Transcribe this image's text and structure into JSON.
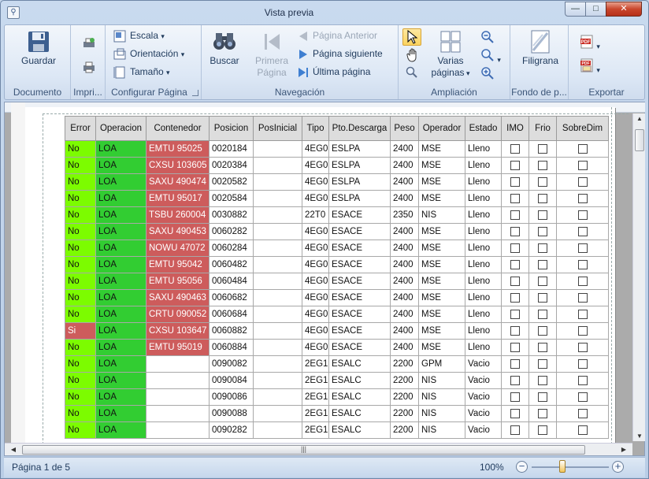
{
  "window": {
    "title": "Vista previa"
  },
  "ribbon": {
    "groups": {
      "documento": "Documento",
      "imprimir": "Impri...",
      "configurar": "Configurar Página",
      "navegacion": "Navegación",
      "ampliacion": "Ampliación",
      "fondo": "Fondo de p...",
      "exportar": "Exportar"
    },
    "guardar": "Guardar",
    "escala": "Escala",
    "orientacion": "Orientación",
    "tamano": "Tamaño",
    "buscar": "Buscar",
    "primera1": "Primera",
    "primera2": "Página",
    "anterior": "Página Anterior",
    "siguiente": "Página siguiente",
    "ultima": "Última página",
    "varias1": "Varias",
    "varias2": "páginas",
    "filigrana": "Filigrana",
    "pdf": "PDF"
  },
  "table": {
    "headers": [
      "Error",
      "Operacion",
      "Contenedor",
      "Posicion",
      "PosInicial",
      "Tipo",
      "Pto.Descarga",
      "Peso",
      "Operador",
      "Estado",
      "IMO",
      "Frio",
      "SobreDim"
    ],
    "rows": [
      [
        "No",
        "LOA",
        "EMTU 95025",
        "0020184",
        "",
        "4EG0",
        "ESLPA",
        "2400",
        "MSE",
        "Lleno"
      ],
      [
        "No",
        "LOA",
        "CXSU 103605",
        "0020384",
        "",
        "4EG0",
        "ESLPA",
        "2400",
        "MSE",
        "Lleno"
      ],
      [
        "No",
        "LOA",
        "SAXU 490474",
        "0020582",
        "",
        "4EG0",
        "ESLPA",
        "2400",
        "MSE",
        "Lleno"
      ],
      [
        "No",
        "LOA",
        "EMTU 95017",
        "0020584",
        "",
        "4EG0",
        "ESLPA",
        "2400",
        "MSE",
        "Lleno"
      ],
      [
        "No",
        "LOA",
        "TSBU 260004",
        "0030882",
        "",
        "22T0",
        "ESACE",
        "2350",
        "NIS",
        "Lleno"
      ],
      [
        "No",
        "LOA",
        "SAXU 490453",
        "0060282",
        "",
        "4EG0",
        "ESACE",
        "2400",
        "MSE",
        "Lleno"
      ],
      [
        "No",
        "LOA",
        "NOWU 47072",
        "0060284",
        "",
        "4EG0",
        "ESACE",
        "2400",
        "MSE",
        "Lleno"
      ],
      [
        "No",
        "LOA",
        "EMTU 95042",
        "0060482",
        "",
        "4EG0",
        "ESACE",
        "2400",
        "MSE",
        "Lleno"
      ],
      [
        "No",
        "LOA",
        "EMTU 95056",
        "0060484",
        "",
        "4EG0",
        "ESACE",
        "2400",
        "MSE",
        "Lleno"
      ],
      [
        "No",
        "LOA",
        "SAXU 490463",
        "0060682",
        "",
        "4EG0",
        "ESACE",
        "2400",
        "MSE",
        "Lleno"
      ],
      [
        "No",
        "LOA",
        "CRTU 090052",
        "0060684",
        "",
        "4EG0",
        "ESACE",
        "2400",
        "MSE",
        "Lleno"
      ],
      [
        "Si",
        "LOA",
        "CXSU 103647",
        "0060882",
        "",
        "4EG0",
        "ESACE",
        "2400",
        "MSE",
        "Lleno"
      ],
      [
        "No",
        "LOA",
        "EMTU 95019",
        "0060884",
        "",
        "4EG0",
        "ESACE",
        "2400",
        "MSE",
        "Lleno"
      ],
      [
        "No",
        "LOA",
        "",
        "0090082",
        "",
        "2EG1",
        "ESALC",
        "2200",
        "GPM",
        "Vacio"
      ],
      [
        "No",
        "LOA",
        "",
        "0090084",
        "",
        "2EG1",
        "ESALC",
        "2200",
        "NIS",
        "Vacio"
      ],
      [
        "No",
        "LOA",
        "",
        "0090086",
        "",
        "2EG1",
        "ESALC",
        "2200",
        "NIS",
        "Vacio"
      ],
      [
        "No",
        "LOA",
        "",
        "0090088",
        "",
        "2EG1",
        "ESALC",
        "2200",
        "NIS",
        "Vacio"
      ],
      [
        "No",
        "LOA",
        "",
        "0090282",
        "",
        "2EG1",
        "ESALC",
        "2200",
        "NIS",
        "Vacio"
      ]
    ]
  },
  "status": {
    "page": "Página 1 de 5",
    "zoom": "100%",
    "zoom_level": 0.4
  }
}
